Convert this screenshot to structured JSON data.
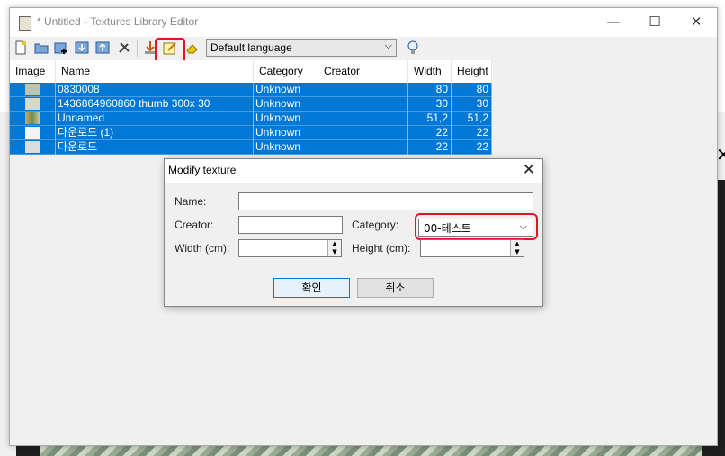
{
  "window": {
    "title": "* Untitled - Textures Library Editor",
    "controls": {
      "minimize": "—",
      "maximize": "☐",
      "close": "✕"
    }
  },
  "toolbar": {
    "icons": [
      "new-file-icon",
      "open-folder-icon",
      "add-texture-icon",
      "import-icon",
      "export-icon",
      "settings-icon",
      "download-icon",
      "edit-texture-icon",
      "eraser-icon"
    ],
    "language_select": "Default language",
    "tip_icon": "lightbulb-icon",
    "highlight_color": "#e81123"
  },
  "list": {
    "columns": [
      "Image",
      "Name",
      "Category",
      "Creator",
      "Width",
      "Height"
    ],
    "rows": [
      {
        "name": "0830008",
        "category": "Unknown",
        "creator": "",
        "width": "80",
        "height": "80"
      },
      {
        "name": "1436864960860 thumb 300x 30",
        "category": "Unknown",
        "creator": "",
        "width": "30",
        "height": "30"
      },
      {
        "name": "Unnamed",
        "category": "Unknown",
        "creator": "",
        "width": "51,2",
        "height": "51,2"
      },
      {
        "name": "다운로드 (1)",
        "category": "Unknown",
        "creator": "",
        "width": "22",
        "height": "22"
      },
      {
        "name": "다운로드",
        "category": "Unknown",
        "creator": "",
        "width": "22",
        "height": "22"
      }
    ],
    "selection_color": "#0078d7"
  },
  "dialog": {
    "title": "Modify texture",
    "name_label": "Name:",
    "name_value": "",
    "creator_label": "Creator:",
    "creator_value": "",
    "category_label": "Category:",
    "category_value": "00-테스트",
    "width_label": "Width (cm):",
    "width_value": "",
    "height_label": "Height (cm):",
    "height_value": "",
    "ok_label": "확인",
    "cancel_label": "취소"
  }
}
